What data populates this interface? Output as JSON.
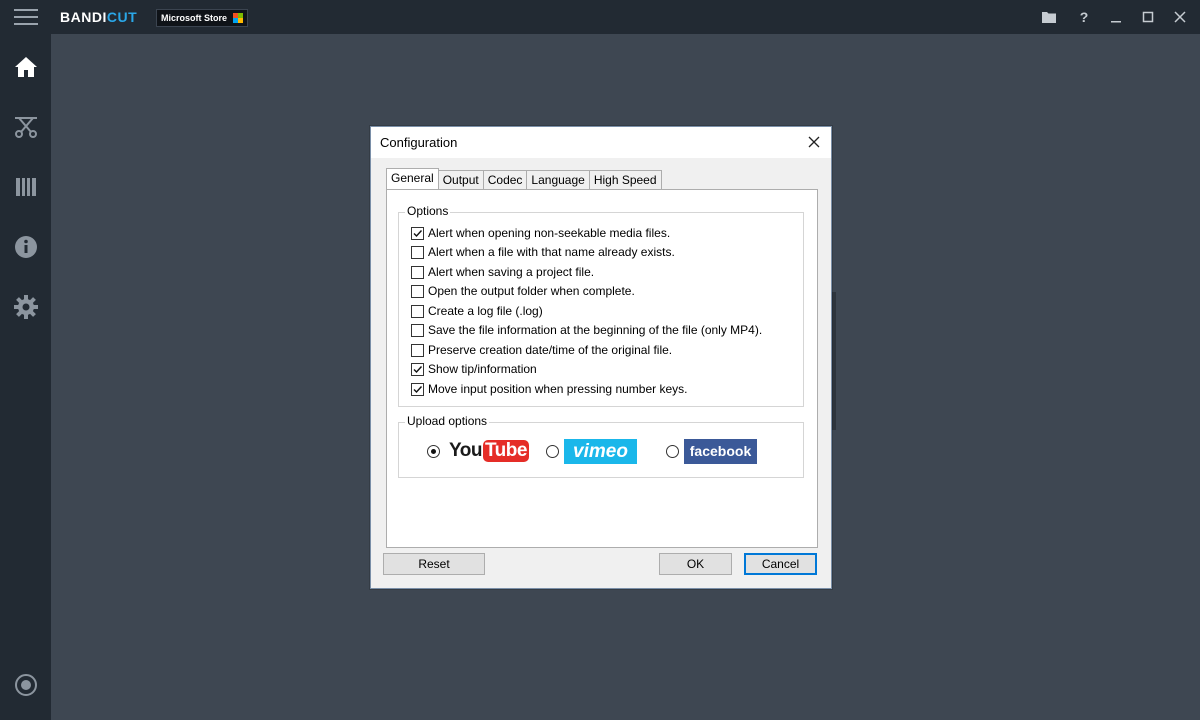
{
  "app": {
    "brand_main": "BANDI",
    "brand_accent": "CUT",
    "store_badge": "Microsoft Store",
    "window_controls": [
      "folder-icon",
      "help-icon",
      "minimize-icon",
      "maximize-icon",
      "close-icon"
    ],
    "help_glyph": "?",
    "accent_color": "#2aa7e8"
  },
  "sidebar": {
    "items": [
      "home-icon",
      "cut-icon",
      "encode-icon",
      "info-icon",
      "settings-icon"
    ],
    "bottom": "record-icon"
  },
  "dialog": {
    "title": "Configuration",
    "tabs": [
      "General",
      "Output",
      "Codec",
      "Language",
      "High Speed"
    ],
    "active_tab": "General",
    "options_group_label": "Options",
    "options": [
      {
        "label": "Alert when opening non-seekable media files.",
        "checked": true
      },
      {
        "label": "Alert when a file with that name already exists.",
        "checked": false
      },
      {
        "label": "Alert when saving a project file.",
        "checked": false
      },
      {
        "label": "Open the output folder when complete.",
        "checked": false
      },
      {
        "label": "Create a log file (.log)",
        "checked": false
      },
      {
        "label": "Save the file information at the beginning of the file (only MP4).",
        "checked": false
      },
      {
        "label": "Preserve creation date/time of the original file.",
        "checked": false
      },
      {
        "label": "Show tip/information",
        "checked": true
      },
      {
        "label": "Move input position when pressing number keys.",
        "checked": true
      }
    ],
    "upload_group_label": "Upload options",
    "upload": [
      {
        "name": "YouTube",
        "logo_text_a": "You",
        "logo_text_b": "Tube",
        "selected": true
      },
      {
        "name": "vimeo",
        "logo_text": "vimeo",
        "selected": false
      },
      {
        "name": "facebook",
        "logo_text": "facebook",
        "selected": false
      }
    ],
    "buttons": {
      "reset": "Reset",
      "ok": "OK",
      "cancel": "Cancel"
    }
  }
}
